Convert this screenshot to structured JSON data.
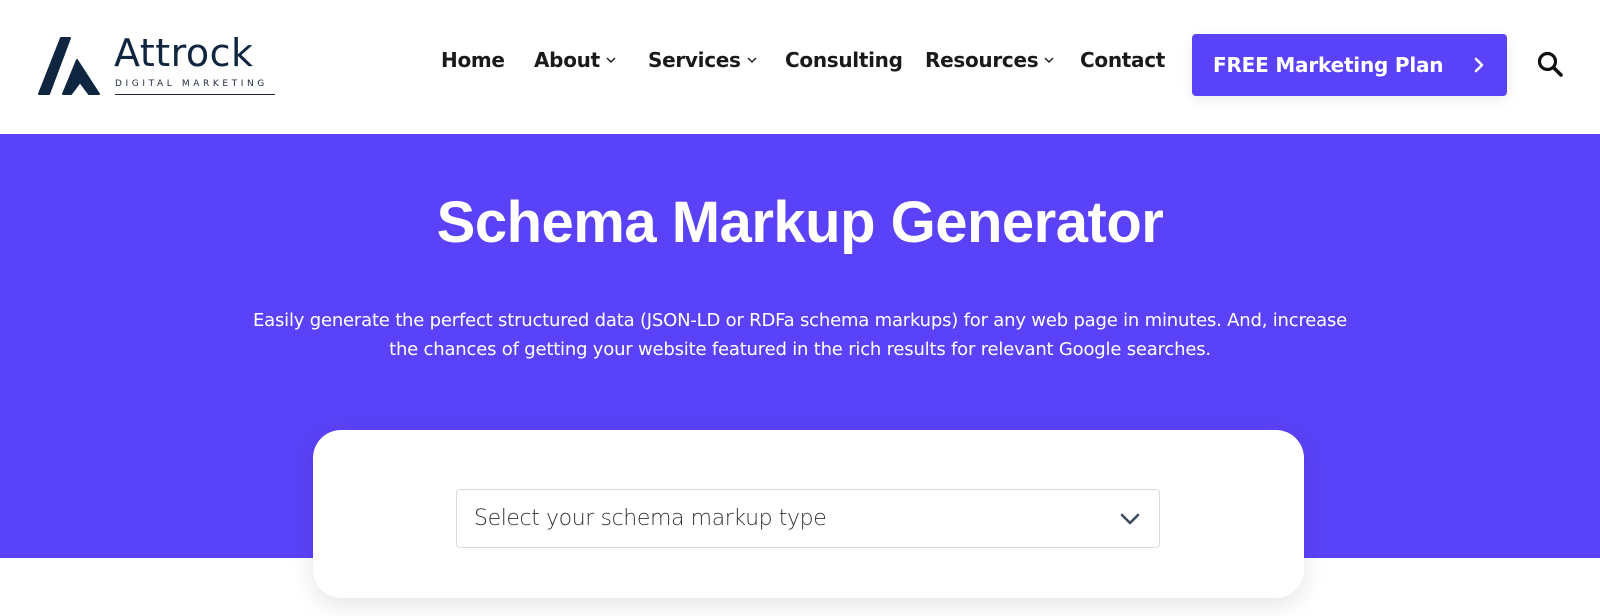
{
  "brand": {
    "name": "Attrock",
    "tagline": "DIGITAL MARKETING",
    "color": "#0f2540"
  },
  "nav": {
    "items": [
      {
        "label": "Home",
        "has_dropdown": false
      },
      {
        "label": "About",
        "has_dropdown": true
      },
      {
        "label": "Services",
        "has_dropdown": true
      },
      {
        "label": "Consulting",
        "has_dropdown": false
      },
      {
        "label": "Resources",
        "has_dropdown": true
      },
      {
        "label": "Contact",
        "has_dropdown": false
      }
    ],
    "cta_label": "FREE Marketing Plan",
    "cta_icon": "chevron-right-icon",
    "search_icon": "search-icon"
  },
  "hero": {
    "title": "Schema Markup Generator",
    "subtitle_line1": "Easily generate the perfect structured data (JSON-LD or RDFa schema markups) for any web page in minutes. And, increase",
    "subtitle_line2": "the chances of getting your website featured in the rich results for relevant Google searches.",
    "background_color": "#5a42f8"
  },
  "form": {
    "schema_type_select": {
      "placeholder": "Select your schema markup type",
      "icon": "chevron-down-icon"
    }
  }
}
